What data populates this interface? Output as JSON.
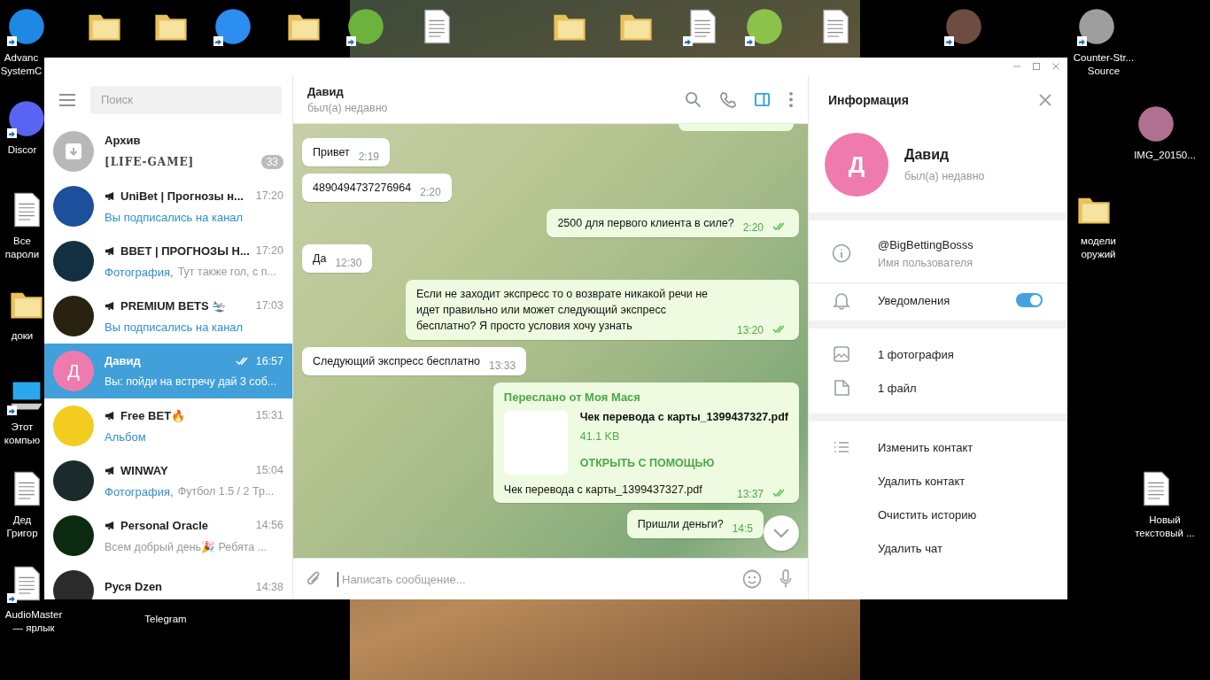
{
  "desktop": {
    "icons": [
      {
        "kind": "app",
        "color": "#1e88e5",
        "shortcut": true,
        "label": [
          "Advanc",
          "SystemC"
        ]
      },
      {
        "kind": "folder",
        "color": "#e8c15a",
        "shortcut": false
      },
      {
        "kind": "folder",
        "color": "#e8c15a",
        "shortcut": false
      },
      {
        "kind": "app",
        "color": "#2b8ef0",
        "shortcut": true
      },
      {
        "kind": "folder",
        "color": "#e8c15a",
        "shortcut": false
      },
      {
        "kind": "app",
        "color": "#6cb33e",
        "shortcut": true
      },
      {
        "kind": "document",
        "color": "#ffffff",
        "shortcut": false
      },
      {
        "kind": "folder",
        "color": "#e8c15a",
        "shortcut": false
      },
      {
        "kind": "folder",
        "color": "#e8c15a",
        "shortcut": false
      },
      {
        "kind": "document",
        "color": "#ffffff",
        "shortcut": true
      },
      {
        "kind": "app",
        "color": "#8bc34a",
        "shortcut": true
      },
      {
        "kind": "document",
        "color": "#ffffff",
        "shortcut": false
      },
      {
        "kind": "app",
        "color": "#6d4c41",
        "shortcut": true
      },
      {
        "kind": "app",
        "color": "#9e9e9e",
        "shortcut": true,
        "label": [
          "Counter-Str...",
          "Source"
        ]
      },
      {
        "kind": "app",
        "color": "#5865f2",
        "shortcut": true,
        "label": [
          "Discor"
        ]
      },
      {
        "kind": "document",
        "color": "#ffffff",
        "shortcut": false,
        "label": [
          "Все",
          "пароли"
        ]
      },
      {
        "kind": "folder",
        "color": "#e8c15a",
        "shortcut": false,
        "label": [
          "доки"
        ]
      },
      {
        "kind": "computer",
        "color": "#29a8f0",
        "shortcut": true,
        "label": [
          "Этот",
          "компью"
        ]
      },
      {
        "kind": "document",
        "color": "#ffffff",
        "shortcut": false,
        "label": [
          "Дед",
          "Григор"
        ]
      },
      {
        "kind": "document",
        "color": "#ffffff",
        "shortcut": true,
        "label": [
          "AudioMaster",
          "— ярлык"
        ]
      },
      {
        "kind": "photo",
        "color": "#b07090",
        "shortcut": false,
        "label": [
          "IMG_20150..."
        ]
      },
      {
        "kind": "folder",
        "color": "#e8c15a",
        "shortcut": false,
        "label": [
          "модели",
          "оружий"
        ]
      },
      {
        "kind": "document",
        "color": "#ffffff",
        "shortcut": false,
        "label": [
          "Новый",
          "текстовый ..."
        ]
      },
      {
        "kind": "hidden",
        "label": [
          "Telegram"
        ]
      }
    ]
  },
  "sidebar": {
    "search": {
      "placeholder": "Поиск"
    },
    "archive": {
      "name": "Архив",
      "preview": "[LIFE-GAME]",
      "badge": "33"
    },
    "chats": [
      {
        "name": "UniBet | Прогнозы н...",
        "channel": true,
        "time": "17:20",
        "accent": "Вы подписались на канал",
        "color": "#1c4f9c",
        "read": false,
        "selected": false
      },
      {
        "name": "BBET | ПРОГНОЗЫ Н...",
        "channel": true,
        "time": "17:20",
        "accent": "Фотография,",
        "preview": "Тут также гол, с п...",
        "color": "#12303f",
        "read": false,
        "selected": false
      },
      {
        "name": "PREMIUM BETS 🛬",
        "channel": true,
        "time": "17:03",
        "accent": "Вы подписались на канал",
        "color": "#2a2210",
        "read": false,
        "selected": false
      },
      {
        "name": "Давид",
        "channel": false,
        "time": "16:57",
        "preview": "Вы: пойди на встречу дай 3 соб...",
        "color": "#ee7aae",
        "letter": "Д",
        "read": true,
        "selected": true
      },
      {
        "name": "Free BET🔥",
        "channel": true,
        "time": "15:31",
        "accent": "Альбом",
        "color": "#f2cd1f",
        "read": false,
        "selected": false
      },
      {
        "name": "WINWAY",
        "channel": true,
        "time": "15:04",
        "accent": "Фотография,",
        "preview": "Футбол  1.5 / 2 Тр...",
        "color": "#1b2a2a",
        "read": false,
        "selected": false
      },
      {
        "name": "Personal Oracle",
        "channel": true,
        "time": "14:56",
        "preview": "Всем добрый день🎉 Ребята ...",
        "color": "#0b2a10",
        "read": false,
        "selected": false
      },
      {
        "name": "Руся Dzen",
        "channel": false,
        "time": "14:38",
        "color": "#2b2b2b",
        "selected": false
      }
    ]
  },
  "header": {
    "name": "Давид",
    "status": "был(а) недавно",
    "panel_toggle_selected": true
  },
  "messages": [
    {
      "kind": "text",
      "out": false,
      "text": "Привет",
      "time": "2:19",
      "read": false
    },
    {
      "kind": "text",
      "out": false,
      "text": "4890494737276964",
      "time": "2:20",
      "read": false
    },
    {
      "kind": "text",
      "out": true,
      "text": "2500 для первого клиента в силе?",
      "time": "2:20",
      "read": true
    },
    {
      "kind": "text",
      "out": false,
      "text": "Да",
      "time": "12:30",
      "read": false
    },
    {
      "kind": "text",
      "out": true,
      "text": "Если не заходит экспресс то о возврате никакой речи не идет правильно или может следующий экспресс бесплатно? Я просто условия хочу узнать",
      "time": "13:20",
      "read": true
    },
    {
      "kind": "text",
      "out": false,
      "text": "Следующий экспресс бесплатно",
      "time": "13:33",
      "read": false
    },
    {
      "kind": "file",
      "out": true,
      "forwarded": "Переслано от Моя Мася",
      "file_name": "Чек перевода с карты_1399437327.pdf",
      "size": "41.1 KB",
      "action": "ОТКРЫТЬ С ПОМОЩЬЮ",
      "text": "Чек перевода с карты_1399437327.pdf",
      "time": "13:37",
      "read": true
    },
    {
      "kind": "text",
      "out": true,
      "text": "Пришли деньги?",
      "time": "14:5",
      "read": false
    }
  ],
  "composer": {
    "placeholder": "Написать сообщение..."
  },
  "info": {
    "title": "Информация",
    "name": "Давид",
    "letter": "Д",
    "status": "был(а) недавно",
    "username": "@BigBettingBosss",
    "username_label": "Имя пользователя",
    "notifications": {
      "label": "Уведомления",
      "on": true
    },
    "media": [
      {
        "kind": "photo",
        "label": "1 фотография"
      },
      {
        "kind": "file",
        "label": "1 файл"
      }
    ],
    "actions": [
      {
        "label": "Изменить контакт"
      },
      {
        "label": "Удалить контакт"
      },
      {
        "label": "Очистить историю"
      },
      {
        "label": "Удалить чат"
      }
    ]
  }
}
